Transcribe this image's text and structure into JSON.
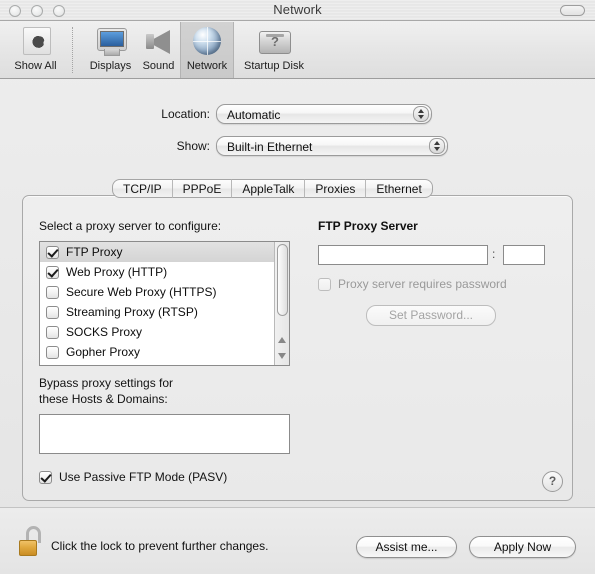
{
  "window": {
    "title": "Network",
    "traffic_lights": [
      "close",
      "minimize",
      "zoom"
    ],
    "toolbar_toggle": "toolbar-toggle-pill"
  },
  "toolbar": {
    "items": [
      {
        "label": "Show All",
        "icon": "show-all-icon",
        "selected": false
      },
      {
        "label": "Displays",
        "icon": "displays-icon",
        "selected": false
      },
      {
        "label": "Sound",
        "icon": "sound-icon",
        "selected": false
      },
      {
        "label": "Network",
        "icon": "network-globe-icon",
        "selected": true
      },
      {
        "label": "Startup Disk",
        "icon": "startup-disk-icon",
        "selected": false
      }
    ]
  },
  "selectors": {
    "location": {
      "label": "Location:",
      "value": "Automatic"
    },
    "show": {
      "label": "Show:",
      "value": "Built-in Ethernet"
    }
  },
  "tabs": [
    {
      "label": "TCP/IP",
      "selected": false
    },
    {
      "label": "PPPoE",
      "selected": false
    },
    {
      "label": "AppleTalk",
      "selected": false
    },
    {
      "label": "Proxies",
      "selected": true
    },
    {
      "label": "Ethernet",
      "selected": false
    }
  ],
  "proxies_pane": {
    "list_heading": "Select a proxy server to configure:",
    "proxy_items": [
      {
        "label": "FTP Proxy",
        "checked": true,
        "selected": true
      },
      {
        "label": "Web Proxy (HTTP)",
        "checked": true,
        "selected": false
      },
      {
        "label": "Secure Web Proxy (HTTPS)",
        "checked": false,
        "selected": false
      },
      {
        "label": "Streaming Proxy (RTSP)",
        "checked": false,
        "selected": false
      },
      {
        "label": "SOCKS Proxy",
        "checked": false,
        "selected": false
      },
      {
        "label": "Gopher Proxy",
        "checked": false,
        "selected": false
      }
    ],
    "bypass_label_line1": "Bypass proxy settings for",
    "bypass_label_line2": "these Hosts & Domains:",
    "bypass_value": "",
    "passive_ftp": {
      "label": "Use Passive FTP Mode (PASV)",
      "checked": true
    },
    "detail": {
      "title": "FTP Proxy Server",
      "host_value": "",
      "separator": ":",
      "port_value": "",
      "requires_password_label": "Proxy server requires password",
      "requires_password_checked": false,
      "requires_password_enabled": false,
      "set_password_label": "Set Password...",
      "set_password_enabled": false
    },
    "help_label": "?"
  },
  "footer": {
    "lock_icon": "unlocked-padlock-icon",
    "lock_text": "Click the lock to prevent further changes.",
    "assist_label": "Assist me...",
    "apply_label": "Apply Now"
  },
  "colors": {
    "window_bg": "#e8e8e8",
    "selection": "#d9d9d9",
    "lock_gold": "#e0a93f",
    "disabled_text": "#999999"
  }
}
